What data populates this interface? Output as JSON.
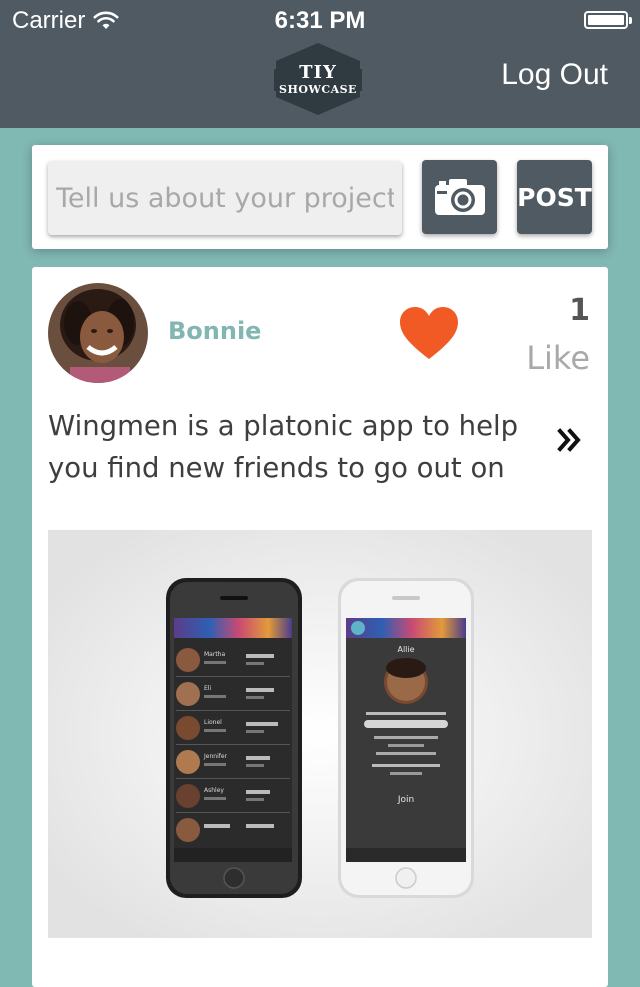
{
  "status_bar": {
    "carrier": "Carrier",
    "time": "6:31 PM",
    "icons": [
      "wifi-icon",
      "battery-icon"
    ]
  },
  "nav": {
    "logo_line1": "TIY",
    "logo_line2": "SHOWCASE",
    "logout_label": "Log Out",
    "background": "#4f5a62"
  },
  "composer": {
    "placeholder": "Tell us about your project!",
    "value": "",
    "camera_icon": "camera-icon",
    "post_label": "POST"
  },
  "post": {
    "author": "Bonnie",
    "like_count": "1",
    "like_label": "Like",
    "description": "Wingmen is a platonic app to help you find new friends to go out on",
    "more_icon": "double-chevron-right-icon",
    "heart_color": "#f15a24",
    "author_color": "#82b6b3"
  },
  "app_screenshot": {
    "dark_phone_rows": [
      "Martha",
      "Eli",
      "Lionel",
      "Jennifer",
      "Ashley",
      ""
    ],
    "light_phone_name": "Allie",
    "light_phone_action": "Join"
  },
  "colors": {
    "page_background": "#80b8b4",
    "header": "#4f5a62",
    "card": "#ffffff"
  }
}
